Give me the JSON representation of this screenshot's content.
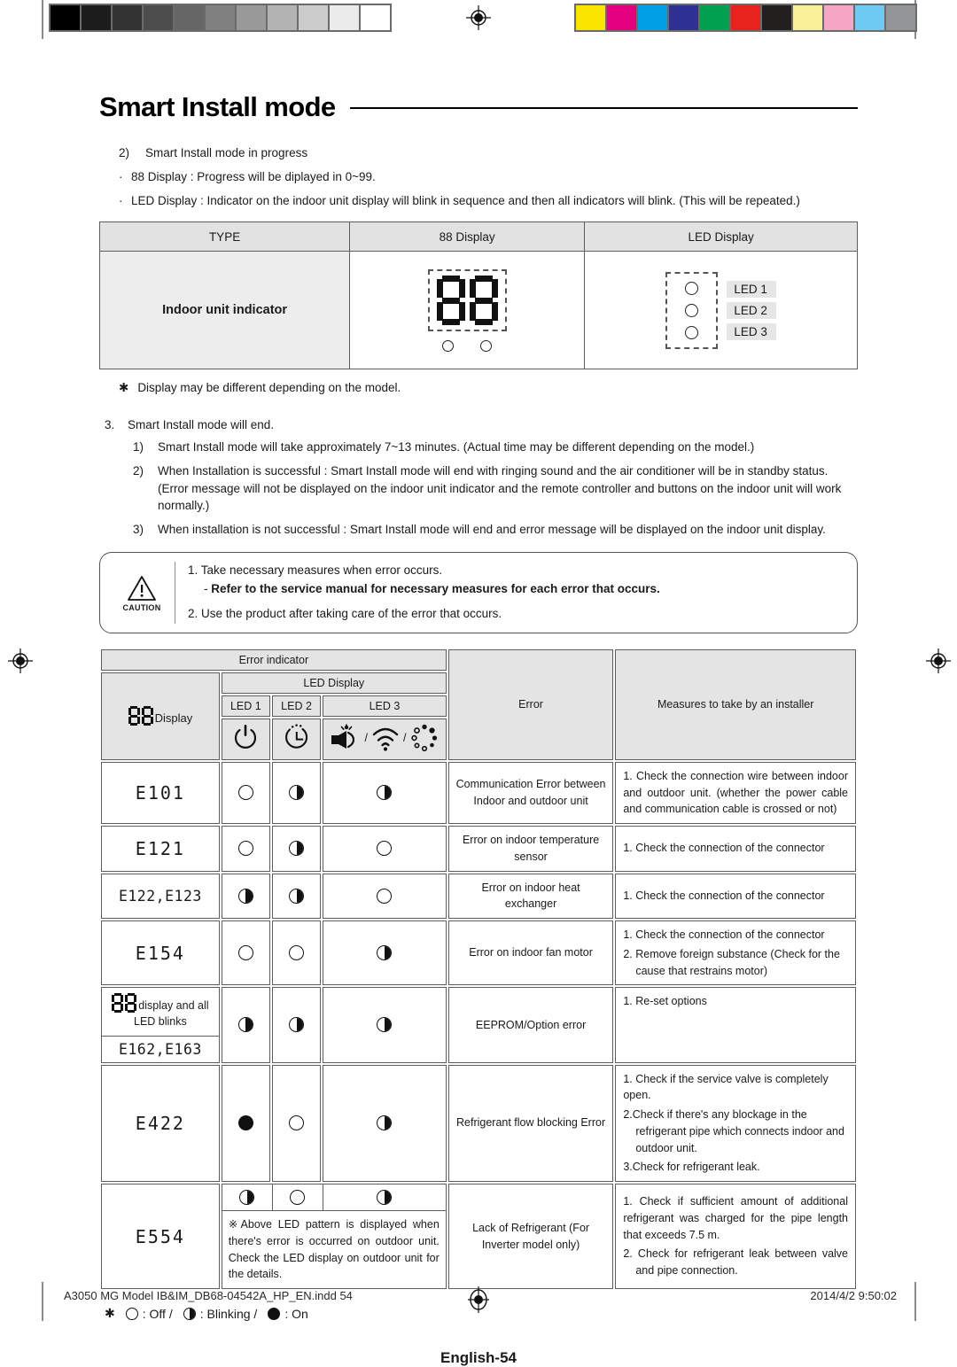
{
  "calibration": {
    "gray_swatches": [
      "#000000",
      "#1c1c1c",
      "#333333",
      "#4d4d4d",
      "#666666",
      "#808080",
      "#999999",
      "#b3b3b3",
      "#cccccc",
      "#ebebeb",
      "#ffffff"
    ],
    "color_swatches": [
      "#fbe500",
      "#e2007f",
      "#00a0e4",
      "#2e3192",
      "#00a050",
      "#e8221d",
      "#231f1e",
      "#fbf09a",
      "#f4a6c4",
      "#6ecaf3",
      "#939598"
    ]
  },
  "header": {
    "title": "Smart Install mode"
  },
  "intro": {
    "item2_num": "2)",
    "item2_text": "Smart Install mode in progress",
    "bullet1": "88 Display : Progress will be diplayed in 0~99.",
    "bullet2": "LED Display : Indicator on the indoor unit display will blink in sequence and then all indicators will blink. (This will be repeated.)"
  },
  "table1": {
    "headers": [
      "TYPE",
      "88 Display",
      "LED Display"
    ],
    "type_value": "Indoor unit indicator",
    "led_labels": [
      "LED 1",
      "LED 2",
      "LED 3"
    ]
  },
  "note_model": "Display may be different depending on the model.",
  "section3": {
    "num": "3.",
    "title": "Smart Install mode will end.",
    "items": [
      {
        "num": "1)",
        "text": "Smart Install mode will take approximately 7~13 minutes. (Actual time may be different depending on the model.)"
      },
      {
        "num": "2)",
        "text": "When Installation is successful : Smart Install mode will end with ringing sound and the air conditioner will be in standby status. (Error message will not be displayed on the indoor unit indicator and the remote controller and buttons on the indoor unit will work normally.)"
      },
      {
        "num": "3)",
        "text": "When installation is not successful : Smart Install mode will end and error message will be displayed on the indoor unit display."
      }
    ]
  },
  "caution": {
    "label": "CAUTION",
    "line1": "1. Take necessary measures when error occurs.",
    "line2_dash": "-",
    "line2": "Refer to the service manual for necessary measures for each error that occurs.",
    "line3": "2. Use the product after taking care of the error that occurs."
  },
  "error_table": {
    "headers": {
      "error_indicator": "Error indicator",
      "display_88": "Display",
      "led_display": "LED Display",
      "led1": "LED 1",
      "led2": "LED 2",
      "led3": "LED 3",
      "error": "Error",
      "measures": "Measures to take by an installer"
    },
    "icons": {
      "led1": "power-icon",
      "led2": "timer-clock-icon",
      "led3a": "plug-sparkle-icon",
      "led3b": "wifi-icon",
      "led3c": "purify-dots-icon",
      "sep": "/"
    },
    "rows": [
      {
        "code": "E101",
        "led1": "off",
        "led2": "blink",
        "led3": "blink",
        "error": "Communication Error between Indoor and outdoor unit",
        "measures": [
          "1. Check the connection wire between indoor and outdoor unit. (whether the power cable and communication cable is crossed or not)"
        ]
      },
      {
        "code": "E121",
        "led1": "off",
        "led2": "blink",
        "led3": "off",
        "error": "Error on indoor temperature sensor",
        "measures": [
          "1. Check the connection of the connector"
        ]
      },
      {
        "code": "E122,E123",
        "led1": "blink",
        "led2": "blink",
        "led3": "off",
        "error": "Error on indoor heat exchanger",
        "measures": [
          "1. Check the connection of the connector"
        ]
      },
      {
        "code": "E154",
        "led1": "off",
        "led2": "off",
        "led3": "blink",
        "error": "Error on indoor fan motor",
        "measures": [
          "1. Check the connection of the connector",
          "2. Remove foreign substance (Check for the cause that restrains motor)"
        ]
      },
      {
        "code": "E162,E163",
        "code_note": "display and all LED blinks",
        "led1": "blink",
        "led2": "blink",
        "led3": "blink",
        "error": "EEPROM/Option error",
        "measures": [
          "1. Re-set options"
        ]
      },
      {
        "code": "E422",
        "led1": "on",
        "led2": "off",
        "led3": "blink",
        "error": "Refrigerant flow blocking Error",
        "measures": [
          "1. Check if the service valve is completely open.",
          "2.Check if there's any blockage in the refrigerant pipe which connects indoor and outdoor unit.",
          "3.Check for refrigerant leak."
        ]
      },
      {
        "code": "E554",
        "led1": "blink",
        "led2": "off",
        "led3": "blink",
        "note": "※Above LED pattern is displayed when there's error is occurred on outdoor unit. Check the LED display on outdoor unit for the details.",
        "error": "Lack of Refrigerant (For Inverter model only)",
        "measures": [
          "1. Check if sufficient amount of additional refrigerant was charged for the pipe length that exceeds 7.5 m.",
          "2. Check for refrigerant leak between valve and pipe connection."
        ]
      }
    ]
  },
  "legend": {
    "star": "✱",
    "off": ": Off /",
    "blinking": ": Blinking /",
    "on": ": On"
  },
  "page_number": "English-54",
  "footer": {
    "file": "A3050 MG Model IB&IM_DB68-04542A_HP_EN.indd   54",
    "timestamp": "2014/4/2   9:50:02"
  }
}
